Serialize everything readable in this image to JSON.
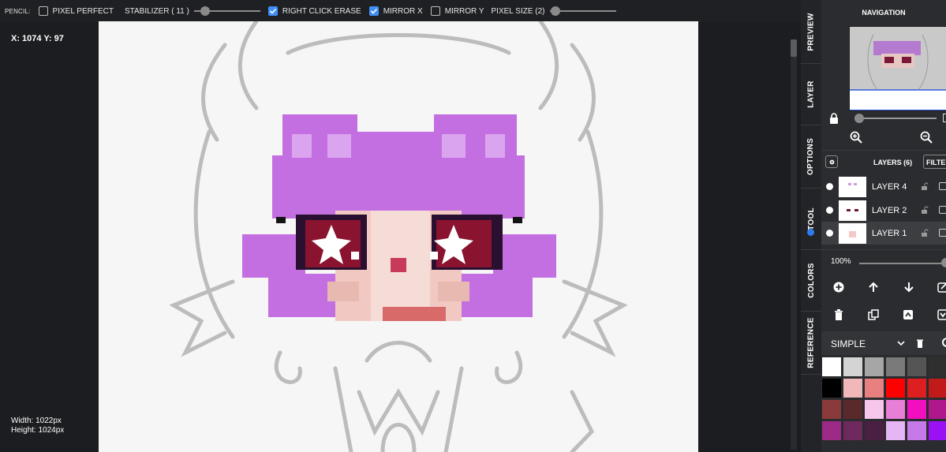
{
  "toolbar": {
    "tool_label": "PENCIL:",
    "pixel_perfect": {
      "label": "PIXEL PERFECT",
      "checked": false
    },
    "stabilizer": {
      "label": "STABILIZER ( 11 )",
      "value": 11
    },
    "right_click_erase": {
      "label": "RIGHT CLICK ERASE",
      "checked": true
    },
    "mirror_x": {
      "label": "MIRROR X",
      "checked": true
    },
    "mirror_y": {
      "label": "MIRROR Y",
      "checked": false
    },
    "pixel_size": {
      "label": "PIXEL SIZE (2)",
      "value": 2
    }
  },
  "status": {
    "coords": "X: 1074 Y: 97",
    "width": "Width: 1022px",
    "height": "Height: 1024px"
  },
  "tabs": [
    "PREVIEW",
    "LAYER",
    "OPTIONS",
    "TOOL",
    "COLORS",
    "REFERENCE"
  ],
  "navigation": {
    "title": "NAVIGATION"
  },
  "layers": {
    "title": "LAYERS (6)",
    "filter_label": "FILTER",
    "items": [
      {
        "name": "LAYER 4",
        "selected": false
      },
      {
        "name": "LAYER 2",
        "selected": false
      },
      {
        "name": "LAYER 1",
        "selected": true
      }
    ],
    "opacity": "100%"
  },
  "palette": {
    "name": "SIMPLE",
    "colors": [
      "#ffffff",
      "#d4d4d4",
      "#a6a6a6",
      "#7a7a7a",
      "#555555",
      "#2f2f2f",
      "#000000",
      "#f0b8b8",
      "#e98080",
      "#ff0000",
      "#dd1f1f",
      "#c01a1a",
      "#8a3a3a",
      "#5a2a2a",
      "#f6c6ec",
      "#e77fd6",
      "#f20fc0",
      "#b0178c",
      "#9c2a86",
      "#6e2a5e",
      "#4a1f44",
      "#e6b6f4",
      "#c57ae8",
      "#9a12f4"
    ]
  }
}
